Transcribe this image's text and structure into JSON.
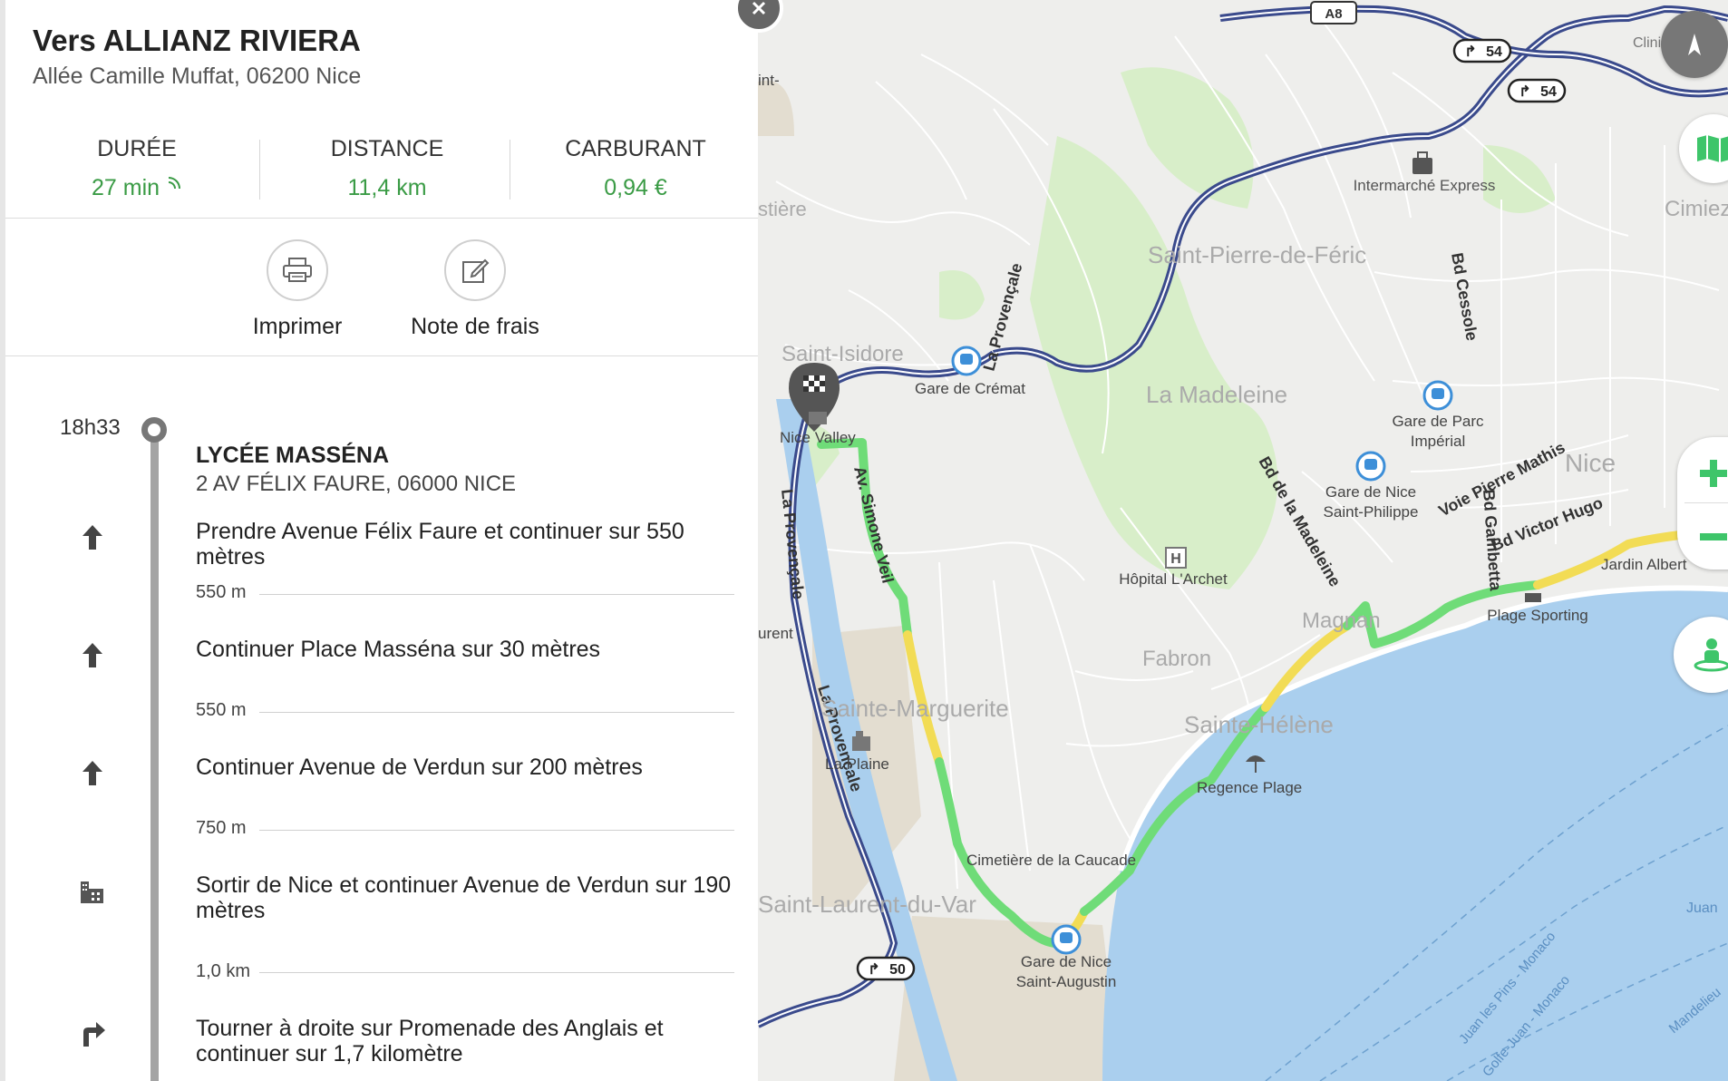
{
  "header": {
    "title": "Vers ALLIANZ RIVIERA",
    "address": "Allée Camille Muffat, 06200 Nice"
  },
  "stats": [
    {
      "label": "DURÉE",
      "value": "27 min"
    },
    {
      "label": "DISTANCE",
      "value": "11,4 km"
    },
    {
      "label": "CARBURANT",
      "value": "0,94 €"
    }
  ],
  "actions": [
    {
      "label": "Imprimer",
      "icon": "printer-icon"
    },
    {
      "label": "Note de frais",
      "icon": "edit-note-icon"
    }
  ],
  "itinerary": {
    "start_time": "18h33",
    "start_name": "LYCÉE MASSÉNA",
    "start_address": "2 AV FÉLIX FAURE, 06000 NICE",
    "steps": [
      {
        "icon": "arrow-up-icon",
        "text": "Prendre Avenue Félix Faure et continuer sur 550 mètres",
        "distance": "550 m"
      },
      {
        "icon": "arrow-up-icon",
        "text": "Continuer Place Masséna sur 30 mètres",
        "distance": "550 m"
      },
      {
        "icon": "arrow-up-icon",
        "text": "Continuer Avenue de Verdun sur 200 mètres",
        "distance": "750 m"
      },
      {
        "icon": "city-icon",
        "text": "Sortir de Nice et continuer Avenue de Verdun sur 190 mètres",
        "distance": "1,0 km"
      },
      {
        "icon": "turn-right-icon",
        "text": "Tourner à droite sur Promenade des Anglais et continuer sur 1,7 kilomètre",
        "distance": ""
      }
    ]
  },
  "map": {
    "labels": {
      "a8": "A8",
      "exit54a": "54",
      "exit54b": "54",
      "exit50": "50",
      "clinique": "Clinique",
      "intermarche": "Intermarché Express",
      "cimiez": "Cimiez",
      "stpierre": "Saint-Pierre-de-Féric",
      "cessole": "Bd Cessole",
      "provencale1": "La Provençale",
      "provencale2": "La Provençale",
      "provencale3": "La Provençale",
      "stisidore": "Saint-Isidore",
      "gare_cremat": "Gare de Crémat",
      "madeleine": "La Madeleine",
      "gare_parc": "Gare de Parc Impérial",
      "nice": "Nice",
      "pierre_mathis": "Voie Pierre Mathis",
      "bd_madeleine": "Bd de la Madeleine",
      "gare_stphilippe": "Gare de Nice Saint-Philippe",
      "bd_gambetta": "Bd Gambetta",
      "bd_victor_hugo": "Bd Victor Hugo",
      "nice_valley": "Nice Valley",
      "simone_veil": "Av. Simone Veil",
      "hopital": "Hôpital L'Archet",
      "jardin": "Jardin Albert",
      "plage_sporting": "Plage Sporting",
      "magnan": "Magnan",
      "fabron": "Fabron",
      "ste_marguerite": "Sainte-Marguerite",
      "ste_helene": "Sainte-Hélène",
      "la_plaine": "La Plaine",
      "regence": "Regence Plage",
      "cimetiere": "Cimetière de la Caucade",
      "gare_staugustin": "Gare de Nice Saint-Augustin",
      "st_laurent": "Saint-Laurent-du-Var",
      "juan": "Juan",
      "juan_pins": "Juan les Pins - Monaco",
      "golfe_juan": "Golfe-Juan - Monaco",
      "mandelieu": "Mandelieu",
      "iere": "stière",
      "urent": "urent",
      "int": "int-"
    },
    "colors": {
      "route_green": "#6fdc78",
      "route_yellow": "#f2dc55",
      "sea": "#aacfee",
      "highway": "#3a4a8c",
      "green_area": "#d8eec9",
      "accent": "#3a9b45"
    }
  }
}
